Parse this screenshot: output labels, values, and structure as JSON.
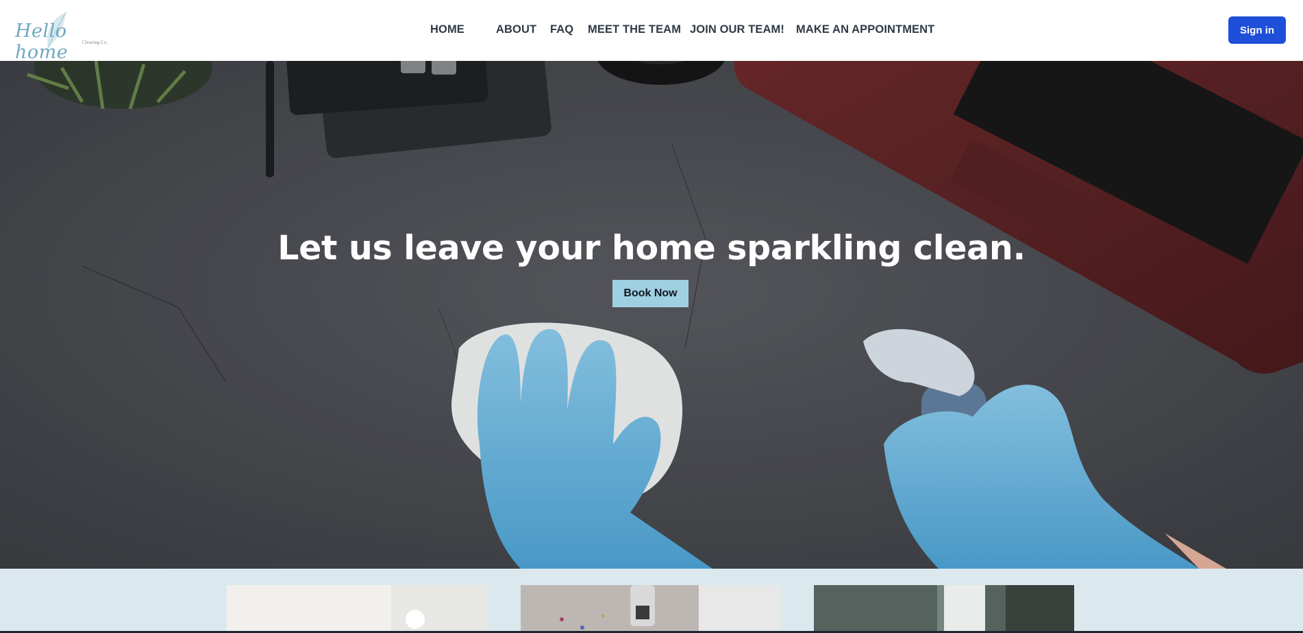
{
  "brand": {
    "logo_script": "Hello home",
    "logo_sub": "Cleaning Co."
  },
  "nav": {
    "items": [
      {
        "label": "HOME"
      },
      {
        "label": "ABOUT"
      },
      {
        "label": "FAQ"
      },
      {
        "label": "MEET THE TEAM"
      },
      {
        "label": "JOIN OUR TEAM!"
      },
      {
        "label": "MAKE AN APPOINTMENT"
      }
    ],
    "signin_label": "Sign in"
  },
  "hero": {
    "title": "Let us leave your home sparkling clean.",
    "cta_label": "Book Now"
  },
  "colors": {
    "accent": "#1d4fd8",
    "cta": "#9fd0e2",
    "cards_bg": "#dbe9ef",
    "hero_surface": "#4f5157"
  },
  "icons": [
    "leaf-logo-icon"
  ]
}
